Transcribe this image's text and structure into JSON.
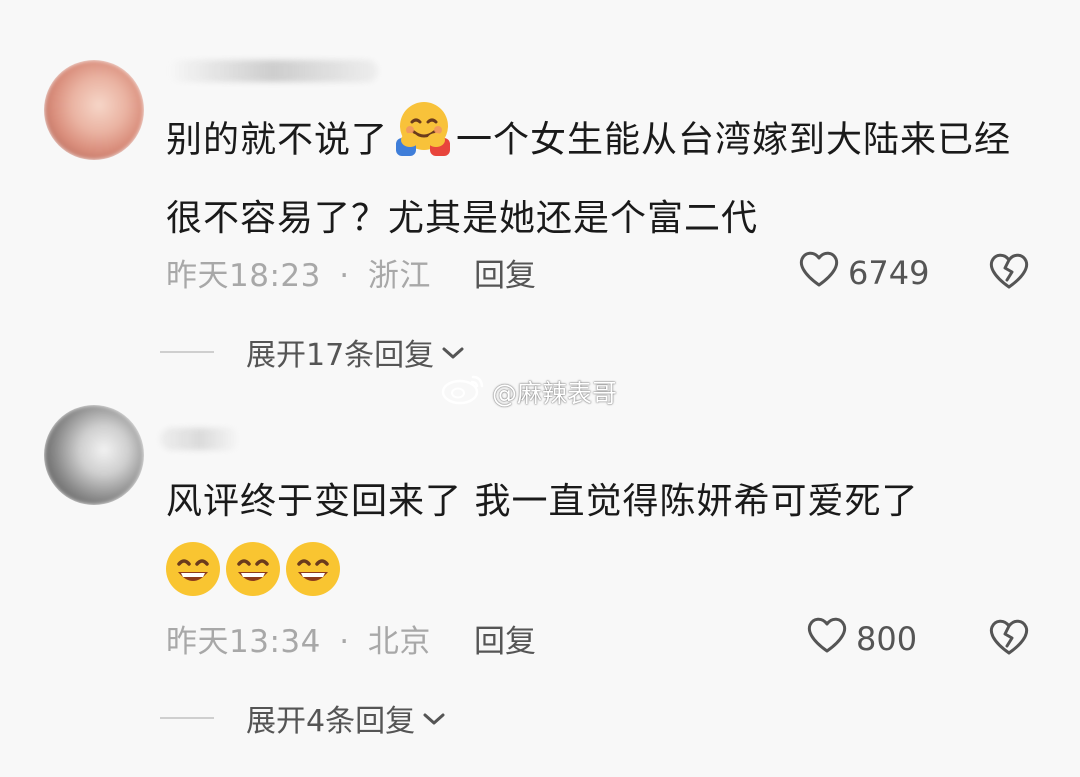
{
  "comments": [
    {
      "text_before": "别的就不说了",
      "emoji": "hugging-face-emoji",
      "text_after": "一个女生能从台湾嫁到大陆来已经很不容易了？尤其是她还是个富二代",
      "time": "昨天18:23",
      "separator": "·",
      "location": "浙江",
      "reply_label": "回复",
      "likes": "6749",
      "expand_label": "展开17条回复"
    },
    {
      "text": "风评终于变回来了 我一直觉得陈妍希可爱死了",
      "emoji_count": 3,
      "time": "昨天13:34",
      "separator": "·",
      "location": "北京",
      "reply_label": "回复",
      "likes": "800",
      "expand_label": "展开4条回复"
    }
  ],
  "watermark": {
    "text": "@麻辣表哥",
    "icon": "weibo-icon"
  },
  "colors": {
    "background": "#f8f8f8",
    "text": "#1a1a1a",
    "meta": "#a8a8a8",
    "action": "#555555"
  }
}
